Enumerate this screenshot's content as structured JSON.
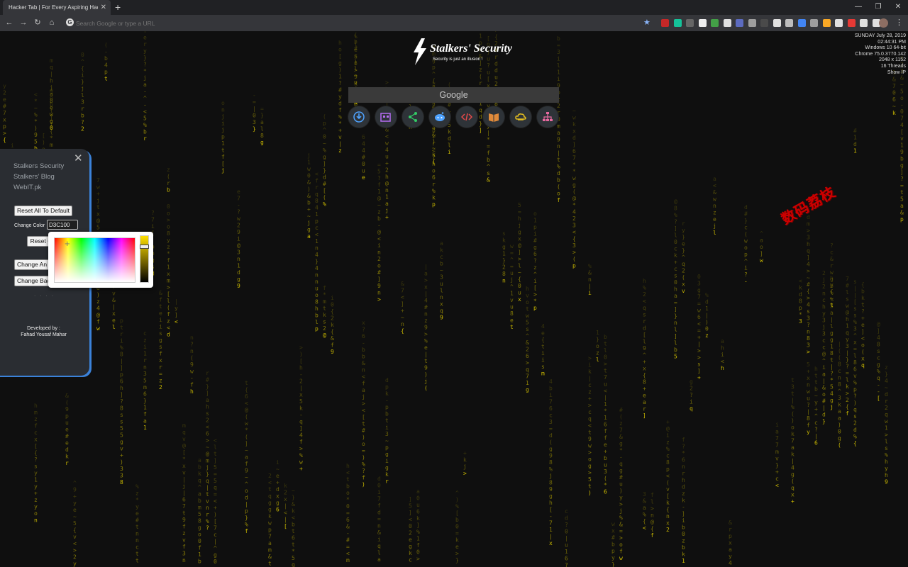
{
  "browser": {
    "tab_title": "Hacker Tab | For Every Aspiring Hacker",
    "tab_close": "✕",
    "new_tab": "+",
    "window_controls": {
      "minimize": "—",
      "maximize": "❐",
      "close": "✕"
    },
    "nav": {
      "back": "←",
      "forward": "→",
      "reload": "↻",
      "home": "⌂"
    },
    "omnibox_placeholder": "Search Google or type a URL",
    "bookmark_star": "★",
    "menu": "⋮",
    "extensions": [
      {
        "name": "adblock-plus-icon",
        "color": "#c62828"
      },
      {
        "name": "grammarly-icon",
        "color": "#15c39a"
      },
      {
        "name": "extension-icon",
        "color": "#666666"
      },
      {
        "name": "extension-icon",
        "color": "#eeeeee"
      },
      {
        "name": "extension-icon",
        "color": "#43a047"
      },
      {
        "name": "extension-icon",
        "color": "#e0e0e0"
      },
      {
        "name": "extension-icon",
        "color": "#5c6bc0"
      },
      {
        "name": "extension-icon",
        "color": "#9e9e9e"
      },
      {
        "name": "extension-icon",
        "color": "#4a4a4a"
      },
      {
        "name": "extension-icon",
        "color": "#e0e0e0"
      },
      {
        "name": "extension-icon",
        "color": "#bdbdbd"
      },
      {
        "name": "translate-icon",
        "color": "#4285f4"
      },
      {
        "name": "extension-icon",
        "color": "#9e9e9e"
      },
      {
        "name": "extension-icon",
        "color": "#f9a825"
      },
      {
        "name": "extension-icon",
        "color": "#e0e0e0"
      },
      {
        "name": "extension-icon",
        "color": "#e53935"
      },
      {
        "name": "camera-icon",
        "color": "#e0e0e0"
      },
      {
        "name": "extension-icon",
        "color": "#e0e0e0"
      }
    ]
  },
  "logo": {
    "name": "Stalkers' Security",
    "tagline": "Security is just an illusion !"
  },
  "sysinfo": [
    "SUNDAY July 28, 2019",
    "02:44:31 PM",
    "Windows 10 64-bit",
    "Chrome 75.0.3770.142",
    "2048 x 1152",
    "16 Threads"
  ],
  "show_ip": "Show IP",
  "search_placeholder": "Google",
  "quick_links": [
    {
      "name": "download-icon",
      "color": "#4fa3ff"
    },
    {
      "name": "apps-icon",
      "color": "#b56cf2"
    },
    {
      "name": "share-icon",
      "color": "#33cc66"
    },
    {
      "name": "reddit-icon",
      "color": "#4fa3ff"
    },
    {
      "name": "code-icon",
      "color": "#e84a4a"
    },
    {
      "name": "book-icon",
      "color": "#e08a3a"
    },
    {
      "name": "cloud-icon",
      "color": "#e6c020"
    },
    {
      "name": "sitemap-icon",
      "color": "#e86aa0"
    }
  ],
  "watermark": "数码荔枝",
  "panel": {
    "close": "✕",
    "links": [
      "Stalkers Security",
      "Stalkers' Blog",
      "WebIT.pk"
    ],
    "reset_all": "Reset All To Default",
    "change_color_label": "Change Color",
    "color_value": "D3C100",
    "reset_color": "Reset C",
    "change_animation": "Change An",
    "change_background": "Change Bac",
    "dots": "· · · ·",
    "developed_by": "Developed by :",
    "developer": "Fahad Yousaf Mahar"
  },
  "colors": {
    "matrix": "#d3c100",
    "accent": "#3b82d9"
  }
}
